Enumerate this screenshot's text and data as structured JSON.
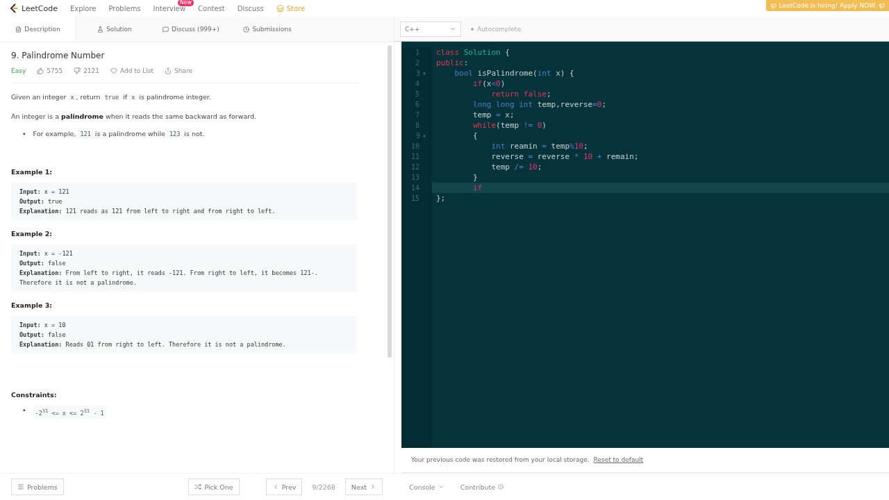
{
  "nav": {
    "brand": "LeetCode",
    "items": [
      {
        "label": "Explore",
        "kind": "link"
      },
      {
        "label": "Problems",
        "kind": "link"
      },
      {
        "label": "Interview",
        "kind": "link",
        "badge": "New"
      },
      {
        "label": "Contest",
        "kind": "link"
      },
      {
        "label": "Discuss",
        "kind": "link"
      },
      {
        "label": "Store",
        "kind": "store"
      }
    ],
    "banner": "LeetCode is hiring! Apply NOW."
  },
  "tabs": [
    {
      "label": "Description",
      "selected": true
    },
    {
      "label": "Solution",
      "selected": false
    },
    {
      "label": "Discuss (999+)",
      "selected": false
    },
    {
      "label": "Submissions",
      "selected": false
    }
  ],
  "problem": {
    "title": "9. Palindrome Number",
    "difficulty": "Easy",
    "likes": "5755",
    "dislikes": "2121",
    "add_to_list": "Add to List",
    "share": "Share",
    "paragraphs": [
      [
        {
          "kind": "text",
          "text": "Given an integer "
        },
        {
          "kind": "code",
          "text": "x"
        },
        {
          "kind": "text",
          "text": ", return "
        },
        {
          "kind": "code",
          "text": "true"
        },
        {
          "kind": "text",
          "text": " if "
        },
        {
          "kind": "code",
          "text": "x"
        },
        {
          "kind": "text",
          "text": " is palindrome integer."
        }
      ],
      [
        {
          "kind": "text",
          "text": "An integer is a "
        },
        {
          "kind": "bold",
          "text": "palindrome"
        },
        {
          "kind": "text",
          "text": " when it reads the same backward as forward."
        }
      ]
    ],
    "bullets": [
      {
        "marker": "•",
        "segments": [
          {
            "kind": "text",
            "text": "For example, "
          },
          {
            "kind": "code",
            "text": "121"
          },
          {
            "kind": "text",
            "text": " is a palindrome while "
          },
          {
            "kind": "code",
            "text": "123"
          },
          {
            "kind": "text",
            "text": " is not."
          }
        ]
      }
    ],
    "examples": [
      {
        "title": "Example 1:",
        "lines": [
          {
            "label": "Input:",
            "value": "x = 121"
          },
          {
            "label": "Output:",
            "value": "true"
          },
          {
            "label": "Explanation:",
            "value": "121 reads as 121 from left to right and from right to left."
          }
        ]
      },
      {
        "title": "Example 2:",
        "lines": [
          {
            "label": "Input:",
            "value": "x = -121"
          },
          {
            "label": "Output:",
            "value": "false"
          },
          {
            "label": "Explanation:",
            "value": "From left to right, it reads -121. From right to left, it becomes 121-."
          },
          {
            "value": "Therefore it is not a palindrome."
          }
        ]
      },
      {
        "title": "Example 3:",
        "lines": [
          {
            "label": "Input:",
            "value": "x = 10"
          },
          {
            "label": "Output:",
            "value": "false"
          },
          {
            "label": "Explanation:",
            "value": "Reads 01 from right to left. Therefore it is not a palindrome."
          }
        ]
      }
    ],
    "constraints_title": "Constraints:",
    "constraints": [
      {
        "marker": "•",
        "text": "-2$^{31}$ <= x <= 2$^{31}$ - 1"
      }
    ]
  },
  "editor": {
    "language": "C++",
    "autocomplete": "Autocomplete",
    "lines": [
      {
        "number": "1",
        "current": false,
        "tokens": [
          {
            "kind": "keyword",
            "text": "class"
          },
          {
            "kind": "name",
            "text": " Solution"
          },
          {
            "kind": "plain",
            "text": " {"
          }
        ]
      },
      {
        "number": "2",
        "current": false,
        "tokens": [
          {
            "kind": "keyword",
            "text": "public"
          },
          {
            "kind": "plain",
            "text": ":"
          }
        ]
      },
      {
        "number": "3",
        "fold": "▾",
        "current": false,
        "tokens": [
          {
            "kind": "type",
            "text": "    bool"
          },
          {
            "kind": "plain",
            "text": " isPalindrome("
          },
          {
            "kind": "type",
            "text": "int"
          },
          {
            "kind": "plain",
            "text": " x) {"
          }
        ]
      },
      {
        "number": "4",
        "current": false,
        "tokens": [
          {
            "kind": "keyword",
            "text": "        if"
          },
          {
            "kind": "plain",
            "text": "(x"
          },
          {
            "kind": "operator",
            "text": "<"
          },
          {
            "kind": "number",
            "text": "0"
          },
          {
            "kind": "plain",
            "text": ")"
          }
        ]
      },
      {
        "number": "5",
        "current": false,
        "tokens": [
          {
            "kind": "keyword",
            "text": "            return"
          },
          {
            "kind": "keyword",
            "text": " false"
          },
          {
            "kind": "plain",
            "text": ";"
          }
        ]
      },
      {
        "number": "6",
        "current": false,
        "tokens": [
          {
            "kind": "type",
            "text": "        long long int"
          },
          {
            "kind": "plain",
            "text": " temp,reverse"
          },
          {
            "kind": "operator",
            "text": "="
          },
          {
            "kind": "number",
            "text": "0"
          },
          {
            "kind": "plain",
            "text": ";"
          }
        ]
      },
      {
        "number": "7",
        "current": false,
        "tokens": [
          {
            "kind": "plain",
            "text": "        temp "
          },
          {
            "kind": "operator",
            "text": "="
          },
          {
            "kind": "plain",
            "text": " x;"
          }
        ]
      },
      {
        "number": "8",
        "current": false,
        "tokens": [
          {
            "kind": "keyword",
            "text": "        while"
          },
          {
            "kind": "plain",
            "text": "(temp "
          },
          {
            "kind": "operator",
            "text": "!="
          },
          {
            "kind": "number",
            "text": " 0"
          },
          {
            "kind": "plain",
            "text": ")"
          }
        ]
      },
      {
        "number": "9",
        "fold": "▾",
        "current": false,
        "tokens": [
          {
            "kind": "plain",
            "text": "        {"
          }
        ]
      },
      {
        "number": "10",
        "current": false,
        "tokens": [
          {
            "kind": "type",
            "text": "            int"
          },
          {
            "kind": "plain",
            "text": " reamin "
          },
          {
            "kind": "operator",
            "text": "="
          },
          {
            "kind": "plain",
            "text": " temp"
          },
          {
            "kind": "operator",
            "text": "%"
          },
          {
            "kind": "number",
            "text": "10"
          },
          {
            "kind": "plain",
            "text": ";"
          }
        ]
      },
      {
        "number": "11",
        "current": false,
        "tokens": [
          {
            "kind": "plain",
            "text": "            reverse "
          },
          {
            "kind": "operator",
            "text": "="
          },
          {
            "kind": "plain",
            "text": " reverse "
          },
          {
            "kind": "operator",
            "text": "*"
          },
          {
            "kind": "number",
            "text": " 10"
          },
          {
            "kind": "operator",
            "text": " +"
          },
          {
            "kind": "plain",
            "text": " remain;"
          }
        ]
      },
      {
        "number": "12",
        "current": false,
        "tokens": [
          {
            "kind": "plain",
            "text": "            temp "
          },
          {
            "kind": "operator",
            "text": "/="
          },
          {
            "kind": "number",
            "text": " 10"
          },
          {
            "kind": "plain",
            "text": ";"
          }
        ]
      },
      {
        "number": "13",
        "current": false,
        "tokens": [
          {
            "kind": "plain",
            "text": "        }"
          }
        ]
      },
      {
        "number": "14",
        "current": true,
        "tokens": [
          {
            "kind": "keyword",
            "text": "        if"
          }
        ]
      },
      {
        "number": "15",
        "current": false,
        "tokens": [
          {
            "kind": "plain",
            "text": "};"
          }
        ]
      }
    ],
    "notice": "Your previous code was restored from your local storage.",
    "reset": "Reset to default"
  },
  "footer": {
    "problems": "Problems",
    "pick_one": "Pick One",
    "prev": "Prev",
    "position": "9/2268",
    "next": "Next",
    "console": "Console",
    "contribute": "Contribute"
  }
}
